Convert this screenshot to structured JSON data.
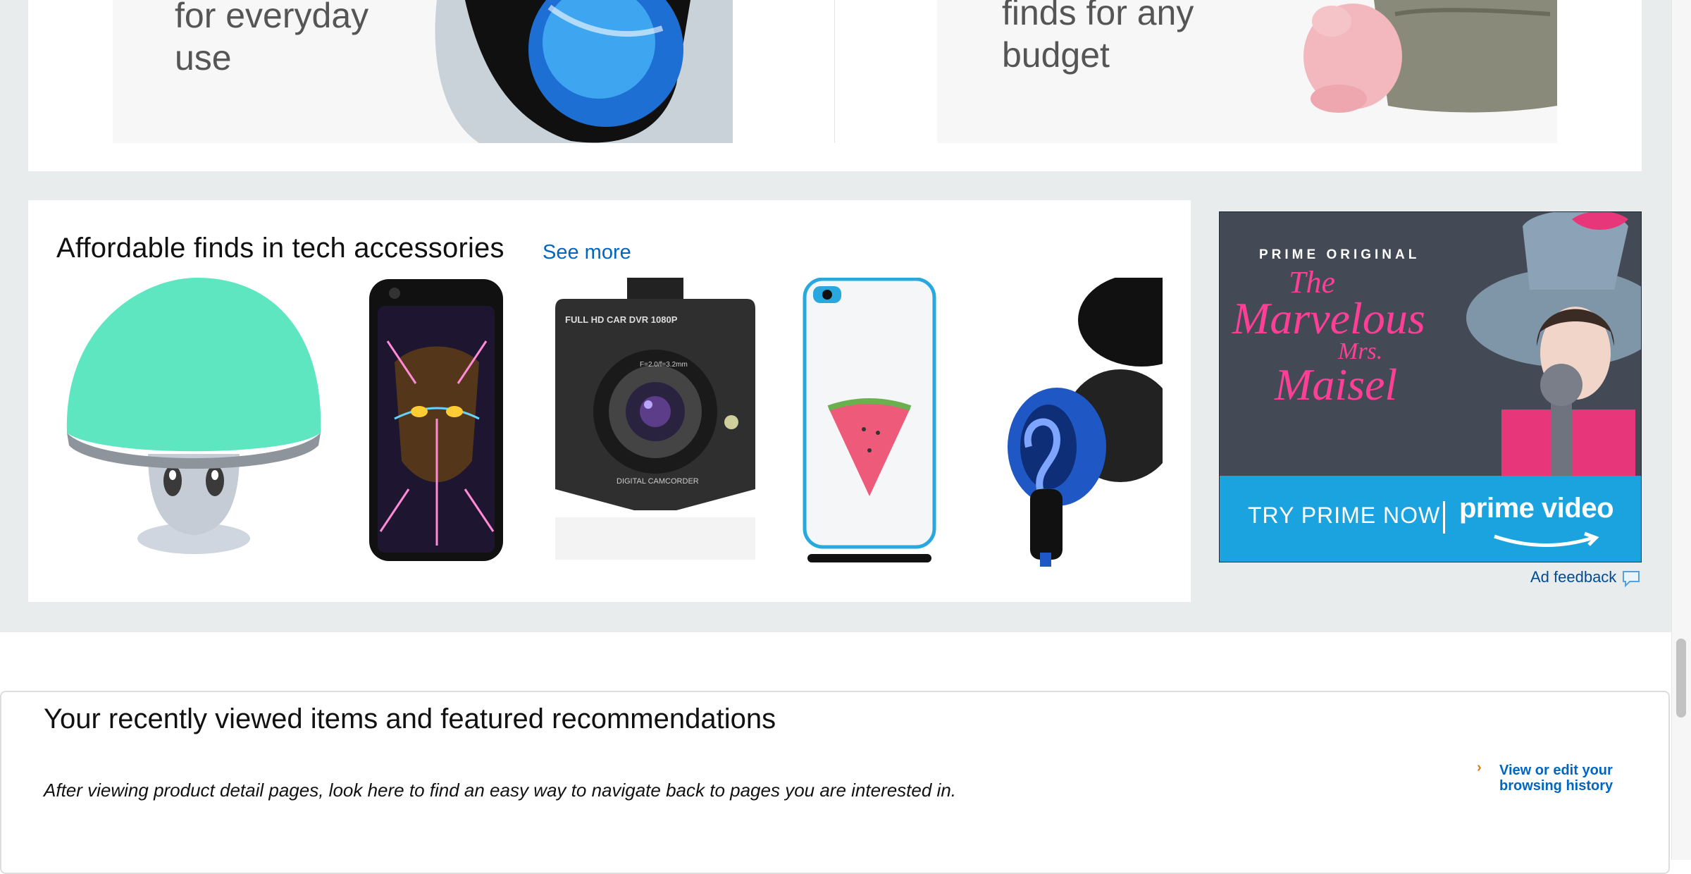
{
  "top_row": {
    "left_promo_text": "for everyday\nuse",
    "right_promo_text": "finds for any\nbudget"
  },
  "tech_card": {
    "title": "Affordable finds in tech accessories",
    "see_more": "See more",
    "products": [
      {
        "name": "mushroom-bluetooth-speaker",
        "color": "#5ee6c0"
      },
      {
        "name": "neon-cat-phone-case",
        "color": "#1a1a1a"
      },
      {
        "name": "car-dvr-dash-camera",
        "color": "#2e2e2e",
        "text_1": "FULL HD CAR DVR 1080P",
        "text_2": "DIGITAL CAMCORDER",
        "text_3": "F=2.0/f=3.2mm"
      },
      {
        "name": "watermelon-phone-case",
        "color": "#f4f4f4"
      },
      {
        "name": "blue-earbuds",
        "color": "#1f57c5"
      }
    ]
  },
  "ad": {
    "eyebrow": "PRIME ORIGINAL",
    "title_line1": "The",
    "title_line2": "Marvelous",
    "title_line3": "Mrs.",
    "title_line4": "Maisel",
    "cta": "TRY PRIME NOW",
    "brand": "prime video",
    "feedback": "Ad feedback",
    "accent_color": "#1aa3de"
  },
  "recently_viewed": {
    "title": "Your recently viewed items and featured recommendations",
    "description": "After viewing product detail pages, look here to find an easy way to navigate back to pages you are interested in.",
    "link": "View or edit your browsing history"
  }
}
